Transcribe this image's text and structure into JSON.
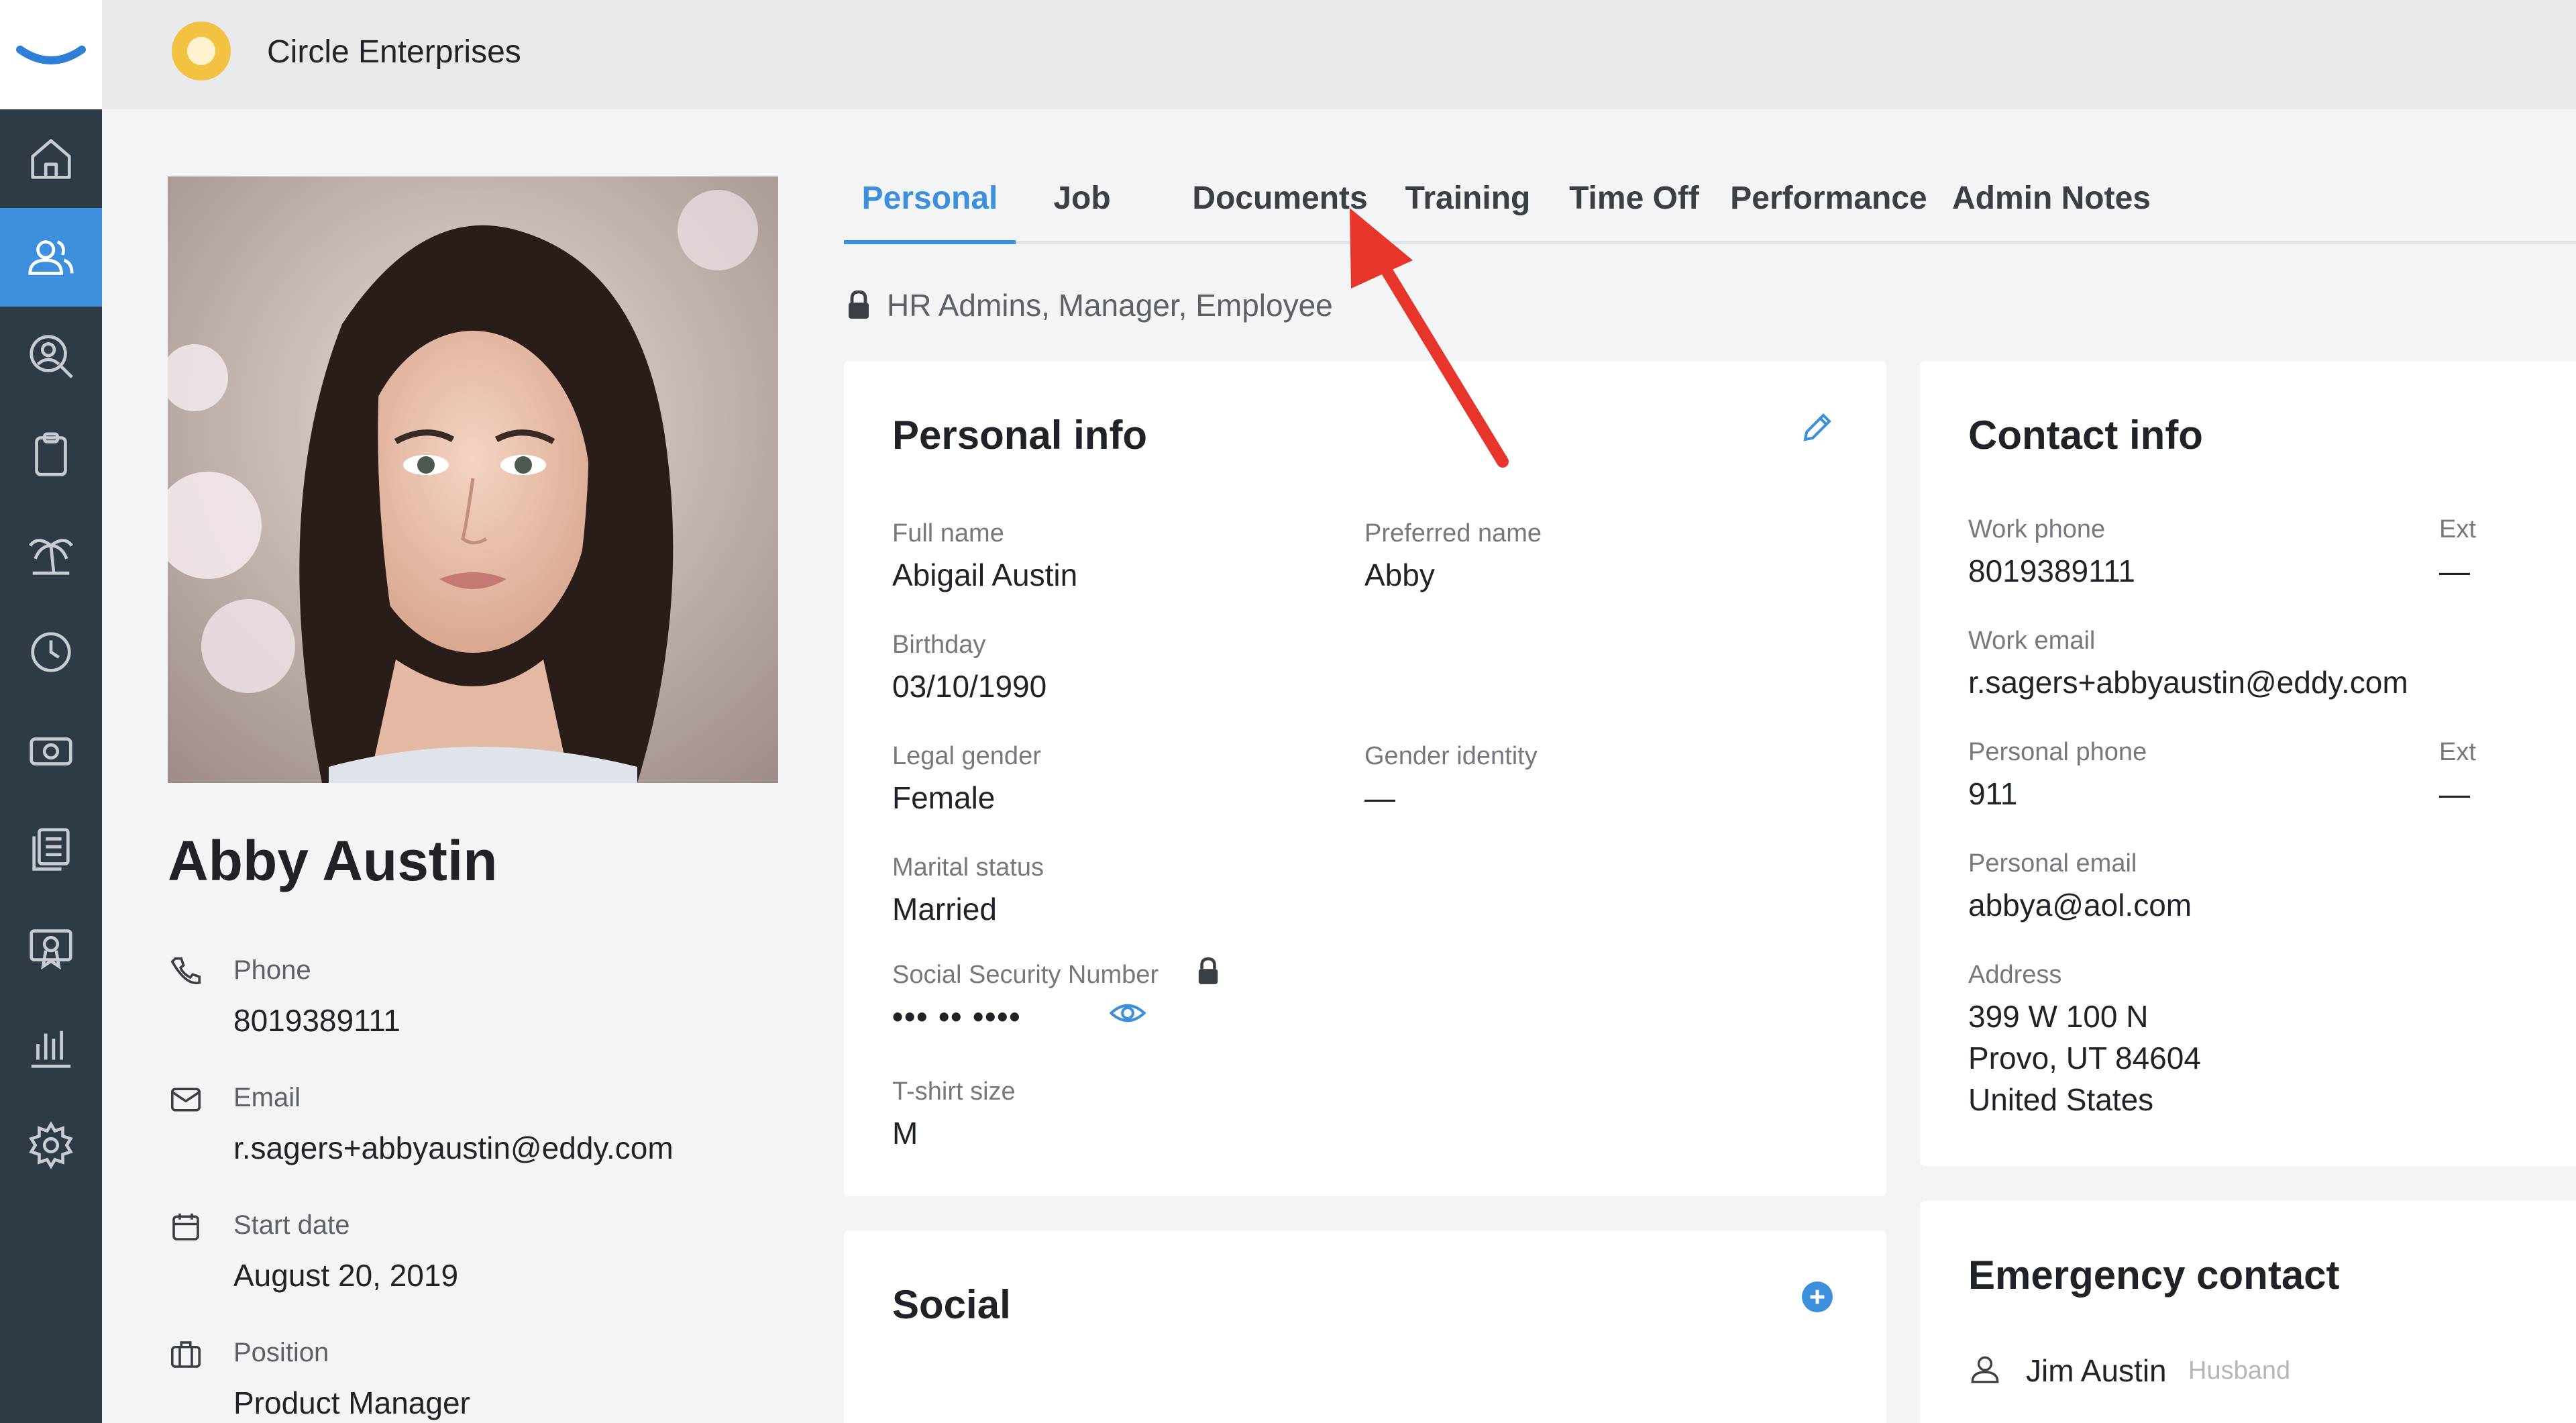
{
  "company": {
    "name": "Circle Enterprises"
  },
  "rail": {
    "items": [
      {
        "icon": "home-icon"
      },
      {
        "icon": "people-icon",
        "active": true
      },
      {
        "icon": "user-search-icon"
      },
      {
        "icon": "clipboard-icon"
      },
      {
        "icon": "palm-tree-icon"
      },
      {
        "icon": "clock-icon"
      },
      {
        "icon": "money-icon"
      },
      {
        "icon": "documents-icon"
      },
      {
        "icon": "certificate-icon"
      },
      {
        "icon": "bar-chart-icon"
      },
      {
        "icon": "gear-icon"
      }
    ]
  },
  "profile": {
    "name": "Abby Austin",
    "phone_label": "Phone",
    "phone": "8019389111",
    "email_label": "Email",
    "email": "r.sagers+abbyaustin@eddy.com",
    "start_label": "Start date",
    "start": "August 20, 2019",
    "position_label": "Position",
    "position": "Product Manager"
  },
  "tabs": [
    "Personal",
    "Job",
    "Documents",
    "Training",
    "Time Off",
    "Performance",
    "Admin Notes"
  ],
  "active_tab": "Personal",
  "visibility": "HR Admins, Manager, Employee",
  "personal_info": {
    "title": "Personal info",
    "full_name_label": "Full name",
    "full_name": "Abigail Austin",
    "preferred_label": "Preferred name",
    "preferred": "Abby",
    "birthday_label": "Birthday",
    "birthday": "03/10/1990",
    "legal_gender_label": "Legal gender",
    "legal_gender": "Female",
    "gender_identity_label": "Gender identity",
    "gender_identity": "—",
    "marital_label": "Marital status",
    "marital": "Married",
    "ssn_label": "Social Security Number",
    "ssn": "••• •• ••••",
    "tshirt_label": "T-shirt size",
    "tshirt": "M"
  },
  "contact_info": {
    "title": "Contact info",
    "work_phone_label": "Work phone",
    "work_phone": "8019389111",
    "ext_label": "Ext",
    "ext_value": "—",
    "work_email_label": "Work email",
    "work_email": "r.sagers+abbyaustin@eddy.com",
    "personal_phone_label": "Personal phone",
    "personal_phone": "911",
    "ext2_label": "Ext",
    "ext2_value": "—",
    "personal_email_label": "Personal email",
    "personal_email": "abbya@aol.com",
    "address_label": "Address",
    "address_line1": "399 W 100 N",
    "address_line2": "Provo, UT 84604",
    "address_line3": "United States"
  },
  "social": {
    "title": "Social"
  },
  "emergency": {
    "title": "Emergency contact",
    "name": "Jim Austin",
    "relation": "Husband"
  },
  "colors": {
    "accent": "#3b8fdc",
    "rail": "#2f3a47",
    "arrow": "#e8352b"
  }
}
